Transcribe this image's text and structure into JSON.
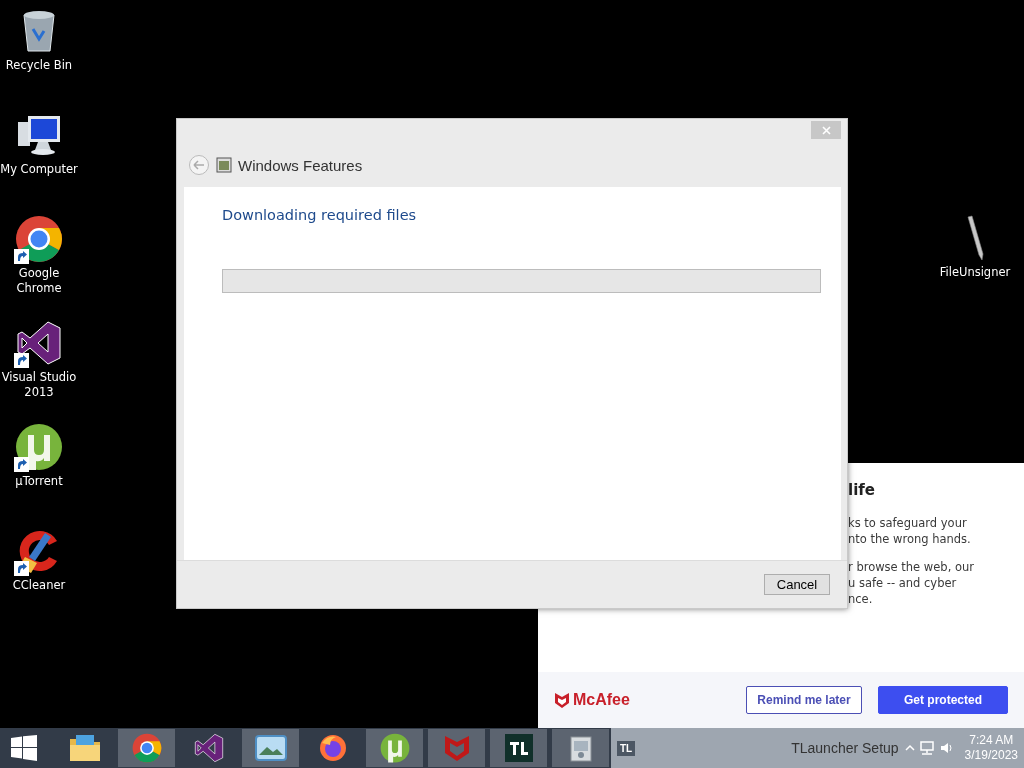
{
  "desktop_icons": [
    {
      "label": "Recycle Bin",
      "kind": "recycle",
      "shortcut": false
    },
    {
      "label": "My Computer",
      "kind": "computer",
      "shortcut": false
    },
    {
      "label": "Google Chrome",
      "kind": "chrome",
      "shortcut": true
    },
    {
      "label": "Visual Studio 2013",
      "kind": "vs",
      "shortcut": true
    },
    {
      "label": "µTorrent",
      "kind": "utorrent",
      "shortcut": true
    },
    {
      "label": "CCleaner",
      "kind": "ccleaner",
      "shortcut": true
    }
  ],
  "right_icon": {
    "label": "FileUnsigner",
    "kind": "pen",
    "shortcut": false
  },
  "popup": {
    "heading": "life",
    "paragraphs": [
      [
        "ks to safeguard your",
        "nto the wrong hands."
      ],
      [
        "r browse the web, our",
        "u safe -- and cyber",
        "nce."
      ]
    ],
    "logo": "McAfee",
    "buttons": [
      {
        "label": "Remind me later",
        "kind": "outline"
      },
      {
        "label": "Get protected",
        "kind": "primary"
      }
    ]
  },
  "dialog": {
    "title": "Windows Features",
    "heading": "Downloading required files",
    "progress": {
      "level": 0
    },
    "buttons": [
      "Cancel"
    ]
  },
  "taskbar": {
    "items": [
      {
        "kind": "explorer",
        "running": false
      },
      {
        "kind": "chrome",
        "running": true
      },
      {
        "kind": "vs",
        "running": false
      },
      {
        "kind": "photos",
        "running": true
      },
      {
        "kind": "firefox",
        "running": false
      },
      {
        "kind": "utorrent",
        "running": true
      },
      {
        "kind": "mcafee",
        "running": true
      },
      {
        "kind": "tl",
        "running": true
      },
      {
        "kind": "installer",
        "running": true
      }
    ],
    "tl_badge": "TL",
    "window_label": "TLauncher Setup",
    "time": "7:24 AM",
    "date": "3/19/2023"
  }
}
